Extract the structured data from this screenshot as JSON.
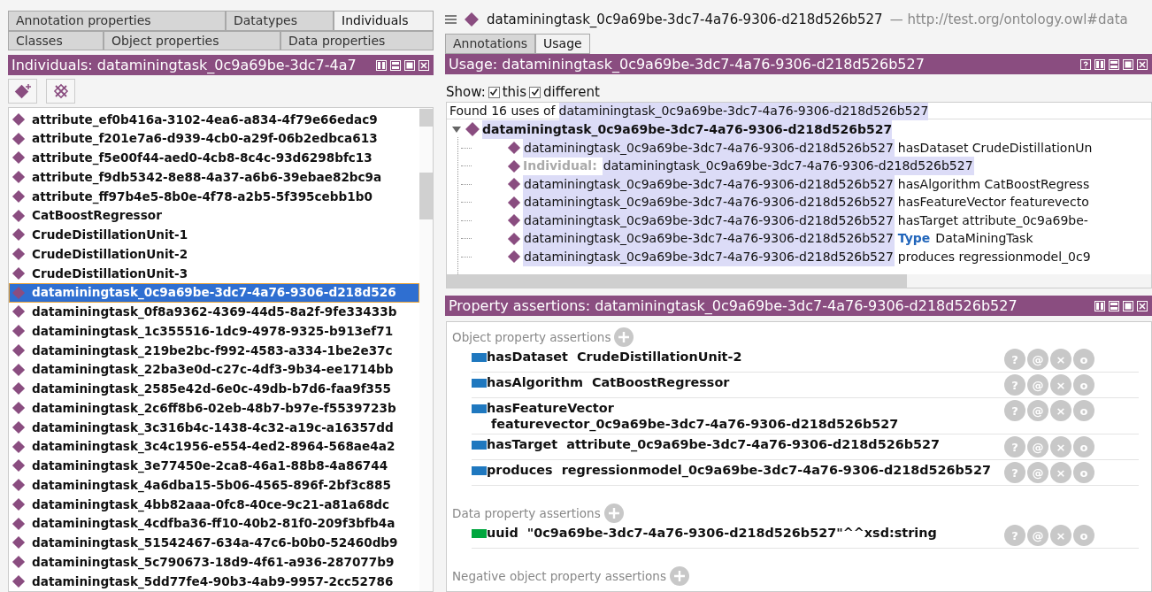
{
  "left_panel": {
    "tabs_row_1": [
      {
        "label": "Annotation properties",
        "selected": false
      },
      {
        "label": "Datatypes",
        "selected": false
      },
      {
        "label": "Individuals",
        "selected": true
      }
    ],
    "tabs_row_2": [
      {
        "label": "Classes",
        "selected": false
      },
      {
        "label": "Object properties",
        "selected": false
      },
      {
        "label": "Data properties",
        "selected": false
      }
    ],
    "header": "Individuals: dataminingtask_0c9a69be-3dc7-4a7",
    "individuals": [
      {
        "name": "attribute_ef0b416a-3102-4ea6-a834-4f79e66edac9",
        "selected": false
      },
      {
        "name": "attribute_f201e7a6-d939-4cb0-a29f-06b2edbca613",
        "selected": false
      },
      {
        "name": "attribute_f5e00f44-aed0-4cb8-8c4c-93d6298bfc13",
        "selected": false
      },
      {
        "name": "attribute_f9db5342-8e88-4a37-a6b6-39ebae82bc9a",
        "selected": false
      },
      {
        "name": "attribute_ff97b4e5-8b0e-4f78-a2b5-5f395cebb1b0",
        "selected": false
      },
      {
        "name": "CatBoostRegressor",
        "selected": false
      },
      {
        "name": "CrudeDistillationUnit-1",
        "selected": false
      },
      {
        "name": "CrudeDistillationUnit-2",
        "selected": false
      },
      {
        "name": "CrudeDistillationUnit-3",
        "selected": false
      },
      {
        "name": "dataminingtask_0c9a69be-3dc7-4a76-9306-d218d526",
        "selected": true
      },
      {
        "name": "dataminingtask_0f8a9362-4369-44d5-8a2f-9fe33433b",
        "selected": false
      },
      {
        "name": "dataminingtask_1c355516-1dc9-4978-9325-b913ef71",
        "selected": false
      },
      {
        "name": "dataminingtask_219be2bc-f992-4583-a334-1be2e37c",
        "selected": false
      },
      {
        "name": "dataminingtask_22ba3e0d-c27c-4df3-9b34-ee1714bb",
        "selected": false
      },
      {
        "name": "dataminingtask_2585e42d-6e0c-49db-b7d6-faa9f355",
        "selected": false
      },
      {
        "name": "dataminingtask_2c6ff8b6-02eb-48b7-b97e-f5539723b",
        "selected": false
      },
      {
        "name": "dataminingtask_3c316b4c-1438-4c32-a19c-a16357dd",
        "selected": false
      },
      {
        "name": "dataminingtask_3c4c1956-e554-4ed2-8964-568ae4a2",
        "selected": false
      },
      {
        "name": "dataminingtask_3e77450e-2ca8-46a1-88b8-4a86744",
        "selected": false
      },
      {
        "name": "dataminingtask_4a6dba15-5b06-4565-896f-2bf3c885",
        "selected": false
      },
      {
        "name": "dataminingtask_4bb82aaa-0fc8-40ce-9c21-a81a68dc",
        "selected": false
      },
      {
        "name": "dataminingtask_4cdfba36-ff10-40b2-81f0-209f3bfb4a",
        "selected": false
      },
      {
        "name": "dataminingtask_51542467-634a-47c6-b0b0-52460db9",
        "selected": false
      },
      {
        "name": "dataminingtask_5c790673-18d9-4f61-a936-287077b9",
        "selected": false
      },
      {
        "name": "dataminingtask_5dd77fe4-90b3-4ab9-9957-2cc52786",
        "selected": false
      }
    ]
  },
  "right_panel": {
    "title": "dataminingtask_0c9a69be-3dc7-4a76-9306-d218d526b527",
    "iri": "— http://test.org/ontology.owl#data",
    "tabs": [
      {
        "label": "Annotations",
        "selected": false
      },
      {
        "label": "Usage",
        "selected": true
      }
    ],
    "usage": {
      "header": "Usage: dataminingtask_0c9a69be-3dc7-4a76-9306-d218d526b527",
      "show_label": "Show:",
      "checkboxes": [
        {
          "label": "this",
          "checked": true
        },
        {
          "label": "different",
          "checked": true
        }
      ],
      "found_prefix": "Found 16 uses of",
      "found_name": "dataminingtask_0c9a69be-3dc7-4a76-9306-d218d526b527",
      "root": {
        "label": "dataminingtask_0c9a69be-3dc7-4a76-9306-d218d526b527",
        "expanded": true,
        "children": [
          {
            "kind": "assertion",
            "subject": "dataminingtask_0c9a69be-3dc7-4a76-9306-d218d526b527",
            "text": "hasDataset CrudeDistillationUn"
          },
          {
            "kind": "individual",
            "keyword": "Individual:",
            "subject": "dataminingtask_0c9a69be-3dc7-4a76-9306-d218d526b527"
          },
          {
            "kind": "assertion",
            "subject": "dataminingtask_0c9a69be-3dc7-4a76-9306-d218d526b527",
            "text": "hasAlgorithm CatBoostRegress"
          },
          {
            "kind": "assertion",
            "subject": "dataminingtask_0c9a69be-3dc7-4a76-9306-d218d526b527",
            "text": "hasFeatureVector featurevecto"
          },
          {
            "kind": "assertion",
            "subject": "dataminingtask_0c9a69be-3dc7-4a76-9306-d218d526b527",
            "text": "hasTarget attribute_0c9a69be-"
          },
          {
            "kind": "type",
            "subject": "dataminingtask_0c9a69be-3dc7-4a76-9306-d218d526b527",
            "keyword": "Type",
            "text": "DataMiningTask"
          },
          {
            "kind": "assertion",
            "subject": "dataminingtask_0c9a69be-3dc7-4a76-9306-d218d526b527",
            "text": "produces regressionmodel_0c9"
          }
        ]
      }
    },
    "property_assertions": {
      "header": "Property assertions: dataminingtask_0c9a69be-3dc7-4a76-9306-d218d526b527",
      "sections": [
        {
          "title": "Object property assertions",
          "assertions": [
            {
              "kind": "object",
              "property": "hasDataset",
              "value": "CrudeDistillationUnit-2",
              "buttons": [
                "?",
                "@",
                "×",
                "o"
              ]
            },
            {
              "kind": "object",
              "property": "hasAlgorithm",
              "value": "CatBoostRegressor",
              "buttons": [
                "?",
                "@",
                "×",
                "o"
              ]
            },
            {
              "kind": "object",
              "property": "hasFeatureVector",
              "value": "featurevector_0c9a69be-3dc7-4a76-9306-d218d526b527",
              "buttons": [
                "?",
                "@",
                "×",
                "o"
              ]
            },
            {
              "kind": "object",
              "property": "hasTarget",
              "value": "attribute_0c9a69be-3dc7-4a76-9306-d218d526b527",
              "buttons": [
                "?",
                "@",
                "×",
                "o"
              ]
            },
            {
              "kind": "object",
              "property": "produces",
              "value": "regressionmodel_0c9a69be-3dc7-4a76-9306-d218d526b527",
              "buttons": [
                "?",
                "@",
                "×",
                "o"
              ]
            }
          ]
        },
        {
          "title": "Data property assertions",
          "assertions": [
            {
              "kind": "data",
              "property": "uuid",
              "value": "\"0c9a69be-3dc7-4a76-9306-d218d526b527\"^^xsd:string",
              "buttons": [
                "?",
                "@",
                "×",
                "o"
              ]
            }
          ]
        },
        {
          "title": "Negative object property assertions"
        }
      ]
    }
  }
}
